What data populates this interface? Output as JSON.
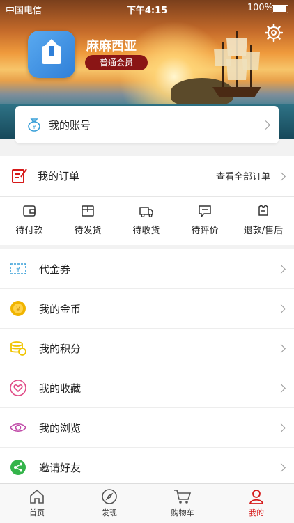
{
  "status_bar": {
    "carrier": "中国电信",
    "time": "下午4:15",
    "battery": "100%"
  },
  "profile": {
    "username": "麻麻西亚",
    "member_level": "普通会员"
  },
  "account": {
    "label": "我的账号"
  },
  "orders": {
    "title": "我的订单",
    "view_all": "查看全部订单",
    "states": [
      {
        "label": "待付款",
        "icon": "wallet-icon"
      },
      {
        "label": "待发货",
        "icon": "package-icon"
      },
      {
        "label": "待收货",
        "icon": "truck-icon"
      },
      {
        "label": "待评价",
        "icon": "comment-icon"
      },
      {
        "label": "退款/售后",
        "icon": "refund-icon"
      }
    ]
  },
  "menu": {
    "items": [
      {
        "label": "代金券",
        "icon": "coupon-icon"
      },
      {
        "label": "我的金币",
        "icon": "gold-coin-icon"
      },
      {
        "label": "我的积分",
        "icon": "points-icon"
      },
      {
        "label": "我的收藏",
        "icon": "heart-icon"
      },
      {
        "label": "我的浏览",
        "icon": "eye-icon"
      },
      {
        "label": "邀请好友",
        "icon": "share-icon"
      }
    ]
  },
  "tabbar": {
    "tabs": [
      {
        "label": "首页",
        "icon": "home-icon"
      },
      {
        "label": "发现",
        "icon": "compass-icon"
      },
      {
        "label": "购物车",
        "icon": "cart-icon"
      },
      {
        "label": "我的",
        "icon": "user-icon"
      }
    ],
    "active_index": 3
  },
  "colors": {
    "accent": "#d61a1a",
    "member_badge": "#8a1515",
    "coupon": "#3aa0d8",
    "gold": "#f0b400",
    "points": "#f0c400",
    "favorites": "#e04a86",
    "browse": "#c04aa8",
    "share": "#34b44a",
    "order_title_icon": "#d61a1a"
  }
}
